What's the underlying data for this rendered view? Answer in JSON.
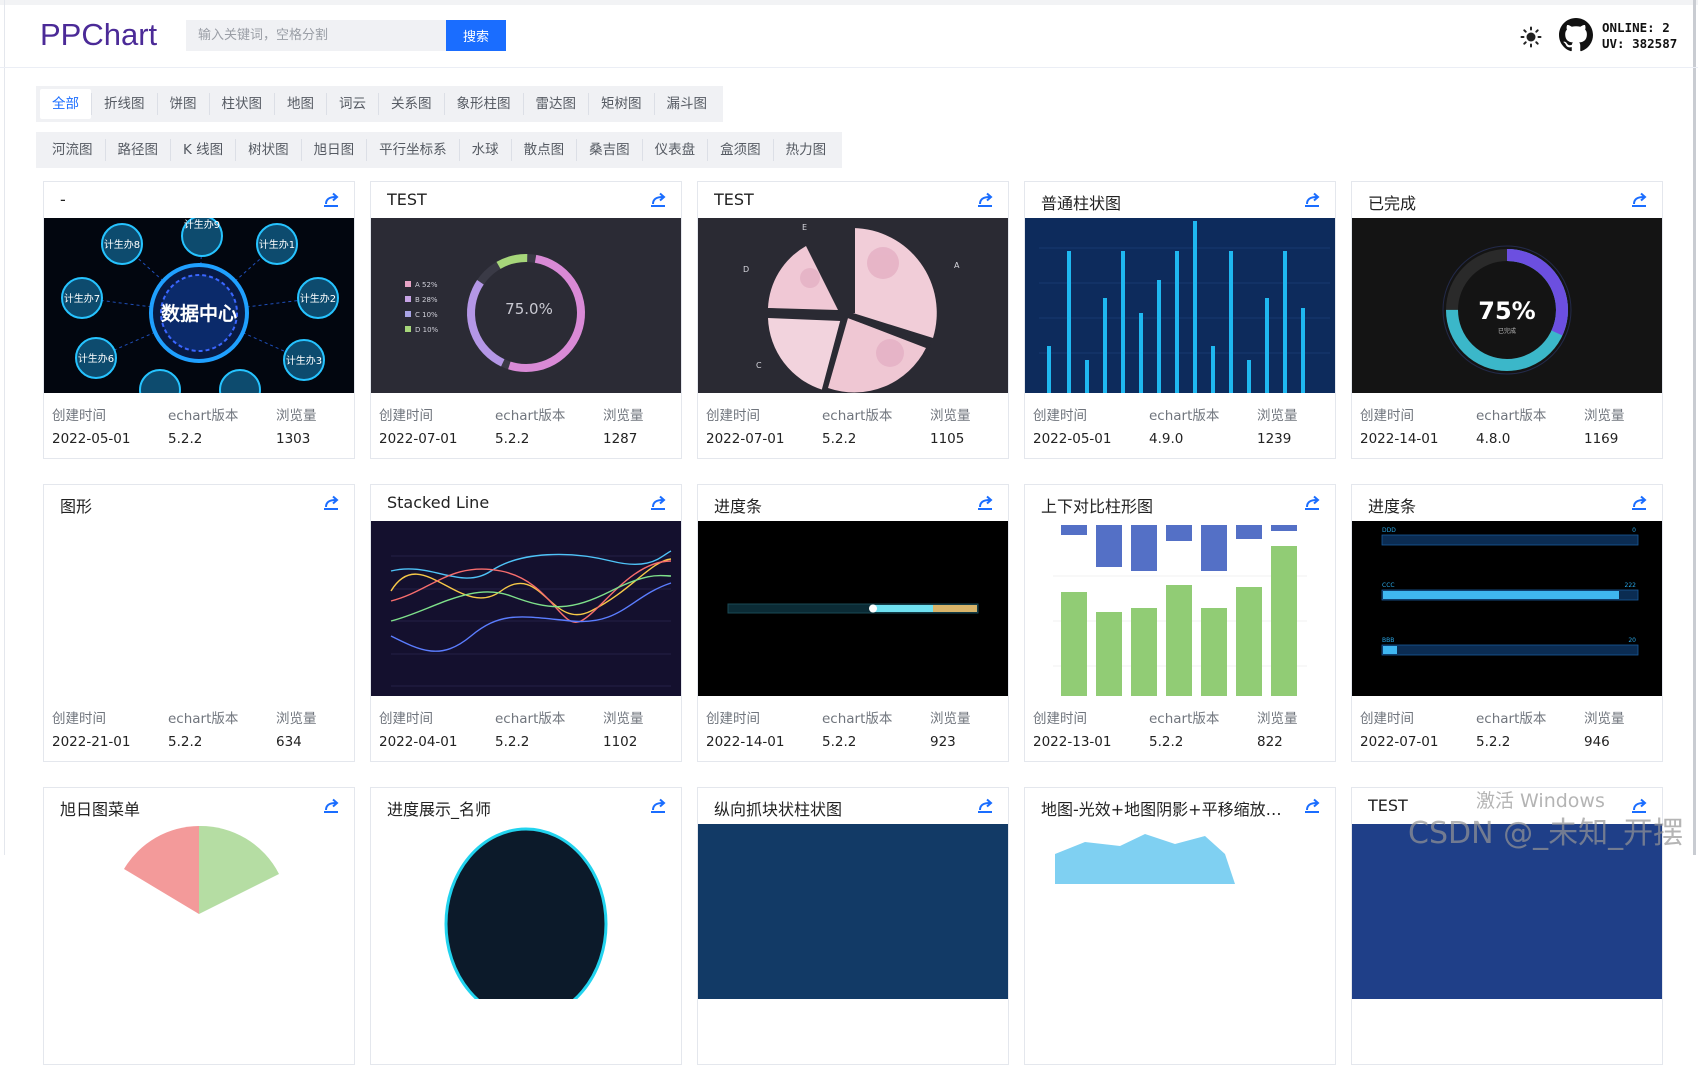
{
  "header": {
    "logo": "PPChart",
    "search_placeholder": "输入关键词，空格分割",
    "search_button": "搜索",
    "online": "ONLINE: 2",
    "uv": "UV: 382587"
  },
  "tabs_row1": [
    "全部",
    "折线图",
    "饼图",
    "柱状图",
    "地图",
    "词云",
    "关系图",
    "象形柱图",
    "雷达图",
    "矩树图",
    "漏斗图"
  ],
  "tabs_row2": [
    "河流图",
    "路径图",
    "K 线图",
    "树状图",
    "旭日图",
    "平行坐标系",
    "水球",
    "散点图",
    "桑吉图",
    "仪表盘",
    "盒须图",
    "热力图"
  ],
  "meta_labels": {
    "created": "创建时间",
    "version": "echart版本",
    "views": "浏览量"
  },
  "cards": [
    {
      "title": "-",
      "created": "2022-05-01",
      "version": "5.2.2",
      "views": "1303"
    },
    {
      "title": "TEST",
      "created": "2022-07-01",
      "version": "5.2.2",
      "views": "1287"
    },
    {
      "title": "TEST",
      "created": "2022-07-01",
      "version": "5.2.2",
      "views": "1105"
    },
    {
      "title": "普通柱状图",
      "created": "2022-05-01",
      "version": "4.9.0",
      "views": "1239"
    },
    {
      "title": "已完成",
      "created": "2022-14-01",
      "version": "4.8.0",
      "views": "1169"
    },
    {
      "title": "图形",
      "created": "2022-21-01",
      "version": "5.2.2",
      "views": "634"
    },
    {
      "title": "Stacked Line",
      "created": "2022-04-01",
      "version": "5.2.2",
      "views": "1102"
    },
    {
      "title": "进度条",
      "created": "2022-14-01",
      "version": "5.2.2",
      "views": "923"
    },
    {
      "title": "上下对比柱形图",
      "created": "2022-13-01",
      "version": "5.2.2",
      "views": "822"
    },
    {
      "title": "进度条",
      "created": "2022-07-01",
      "version": "5.2.2",
      "views": "946"
    },
    {
      "title": "旭日图菜单"
    },
    {
      "title": "进度展示_名师"
    },
    {
      "title": "纵向抓块状柱状图"
    },
    {
      "title": "地图-光效+地图阴影+平移缩放+获..."
    },
    {
      "title": "TEST"
    }
  ],
  "thumbnails": {
    "data_center": {
      "center": "数据中心",
      "nodes": [
        "计生办9",
        "计生办1",
        "计生办2",
        "计生办3",
        "计生办6",
        "计生办7",
        "计生办8"
      ]
    },
    "ring_test": {
      "value": "75.0%",
      "legend": [
        "A 52%",
        "B 28%",
        "C 10%",
        "D 10%"
      ]
    },
    "pie_girl": {
      "slices": [
        "A",
        "C",
        "D",
        "E"
      ]
    },
    "done_gauge": {
      "value": "75%",
      "caption": "已完成"
    },
    "progress_bars": {
      "rows": [
        "DDD",
        "CCC",
        "BBB"
      ],
      "values": [
        "0",
        "222",
        "20"
      ]
    }
  },
  "watermark": {
    "line1": "激活 Windows",
    "line2": "CSDN @_未知_开摆"
  },
  "colors": {
    "accent": "#1a6dff",
    "logo": "#4b2a97"
  }
}
